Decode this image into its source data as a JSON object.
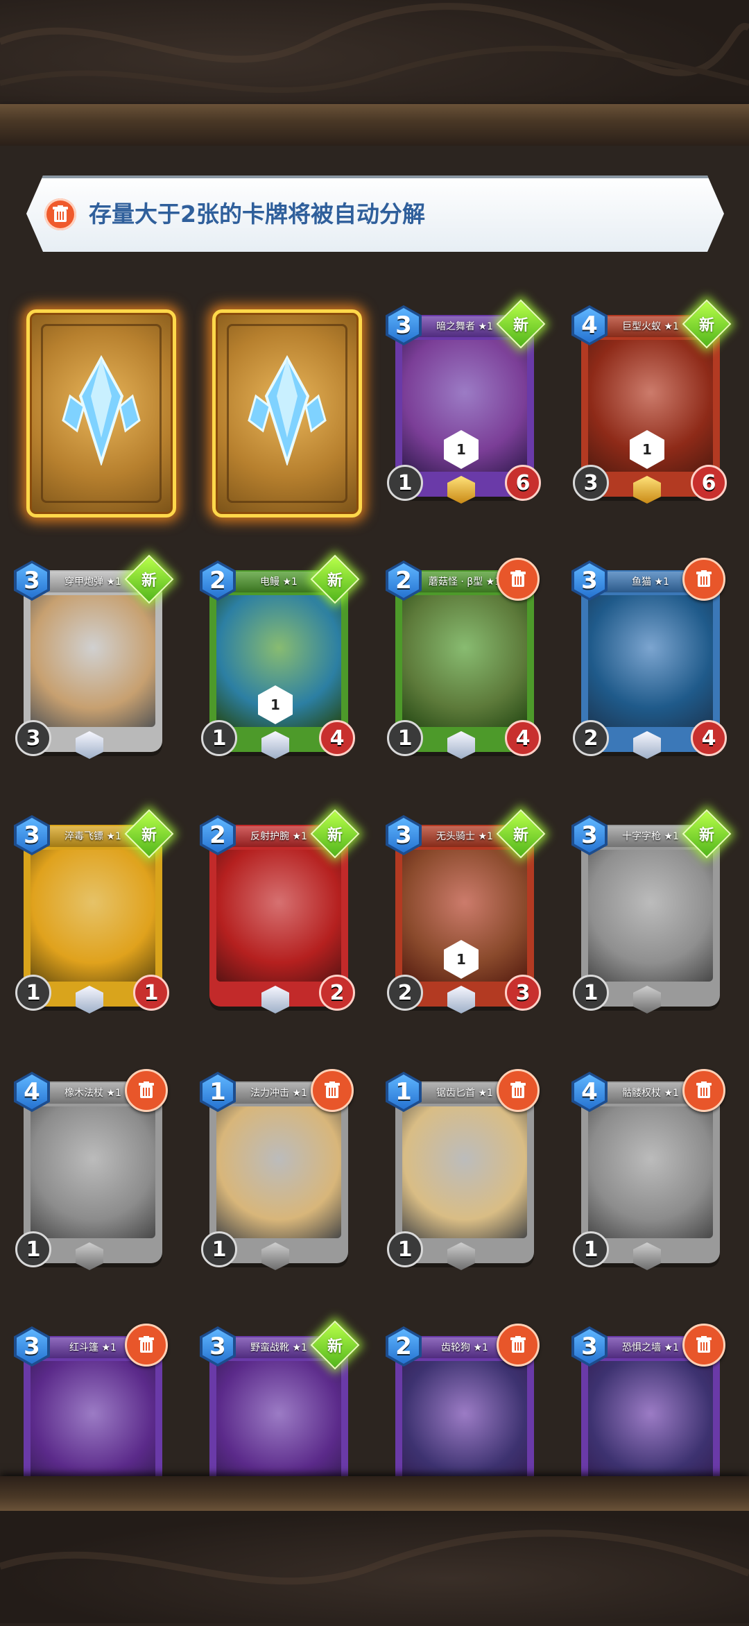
{
  "notice": {
    "text": "存量大于2张的卡牌将被自动分解"
  },
  "badges": {
    "new_label": "新"
  },
  "card_backs": [
    {
      "name": "card-back-1"
    },
    {
      "name": "card-back-2"
    }
  ],
  "cards": [
    {
      "id": "c1",
      "name": "暗之舞者 ★1",
      "cost": "3",
      "atk": "1",
      "hp": "6",
      "skill": "1",
      "badge": "new",
      "color": "#6a3aa8",
      "art": "#7b3e97"
    },
    {
      "id": "c2",
      "name": "巨型火蚁 ★1",
      "cost": "4",
      "atk": "3",
      "hp": "6",
      "skill": "1",
      "badge": "new",
      "color": "#b33a22",
      "art": "#8e2a18"
    },
    {
      "id": "c3",
      "name": "穿甲炮弹 ★1",
      "cost": "3",
      "atk": "3",
      "hp": "",
      "skill": "",
      "badge": "new",
      "color": "#b9b9b9",
      "art": "#c7a070"
    },
    {
      "id": "c4",
      "name": "电鳗 ★1",
      "cost": "2",
      "atk": "1",
      "hp": "4",
      "skill": "1",
      "badge": "new",
      "color": "#4d9a2a",
      "art": "#2c7fa3"
    },
    {
      "id": "c5",
      "name": "蘑菇怪 · β型 ★1",
      "cost": "2",
      "atk": "1",
      "hp": "4",
      "skill": "",
      "badge": "trash",
      "color": "#4d9a2a",
      "art": "#5d7a3a"
    },
    {
      "id": "c6",
      "name": "鱼猫 ★1",
      "cost": "3",
      "atk": "2",
      "hp": "4",
      "skill": "",
      "badge": "trash",
      "color": "#3b78b8",
      "art": "#1f5a8a"
    },
    {
      "id": "c7",
      "name": "淬毒飞镖 ★1",
      "cost": "3",
      "atk": "1",
      "hp": "1",
      "skill": "",
      "badge": "new",
      "color": "#d9a41c",
      "art": "#e0a21d"
    },
    {
      "id": "c8",
      "name": "反射护腕 ★1",
      "cost": "2",
      "atk": "",
      "hp": "2",
      "skill": "",
      "badge": "new",
      "color": "#c22a2a",
      "art": "#b5201f"
    },
    {
      "id": "c9",
      "name": "无头骑士 ★1",
      "cost": "3",
      "atk": "2",
      "hp": "3",
      "skill": "1",
      "badge": "new",
      "color": "#b33a22",
      "art": "#8a4a2c"
    },
    {
      "id": "c10",
      "name": "十字字枪 ★1",
      "cost": "3",
      "atk": "1",
      "hp": "",
      "skill": "",
      "badge": "new",
      "color": "#9a9a9a",
      "art": "#8f8f8f"
    },
    {
      "id": "c11",
      "name": "橡木法杖 ★1",
      "cost": "4",
      "atk": "1",
      "hp": "",
      "skill": "",
      "badge": "trash",
      "color": "#9a9a9a",
      "art": "#8c8c8c"
    },
    {
      "id": "c12",
      "name": "法力冲击 ★1",
      "cost": "1",
      "atk": "1",
      "hp": "",
      "skill": "",
      "badge": "trash",
      "color": "#9a9a9a",
      "art": "#d8b67a"
    },
    {
      "id": "c13",
      "name": "锯齿匕首 ★1",
      "cost": "1",
      "atk": "1",
      "hp": "",
      "skill": "",
      "badge": "trash",
      "color": "#9a9a9a",
      "art": "#d9bd85"
    },
    {
      "id": "c14",
      "name": "骷髅权杖 ★1",
      "cost": "4",
      "atk": "1",
      "hp": "",
      "skill": "",
      "badge": "trash",
      "color": "#9a9a9a",
      "art": "#8c8c8c"
    },
    {
      "id": "c15",
      "name": "红斗篷 ★1",
      "cost": "3",
      "atk": "",
      "hp": "",
      "skill": "",
      "badge": "trash",
      "color": "#6a3aa8",
      "art": "#5b2a8a"
    },
    {
      "id": "c16",
      "name": "野蛮战靴 ★1",
      "cost": "3",
      "atk": "",
      "hp": "",
      "skill": "",
      "badge": "new",
      "color": "#6a3aa8",
      "art": "#5b2a8a"
    },
    {
      "id": "c17",
      "name": "齿轮狗 ★1",
      "cost": "2",
      "atk": "",
      "hp": "",
      "skill": "",
      "badge": "trash",
      "color": "#6a3aa8",
      "art": "#3d3270"
    },
    {
      "id": "c18",
      "name": "恐惧之墙 ★1",
      "cost": "3",
      "atk": "",
      "hp": "",
      "skill": "",
      "badge": "trash",
      "color": "#6a3aa8",
      "art": "#3d3270"
    }
  ]
}
